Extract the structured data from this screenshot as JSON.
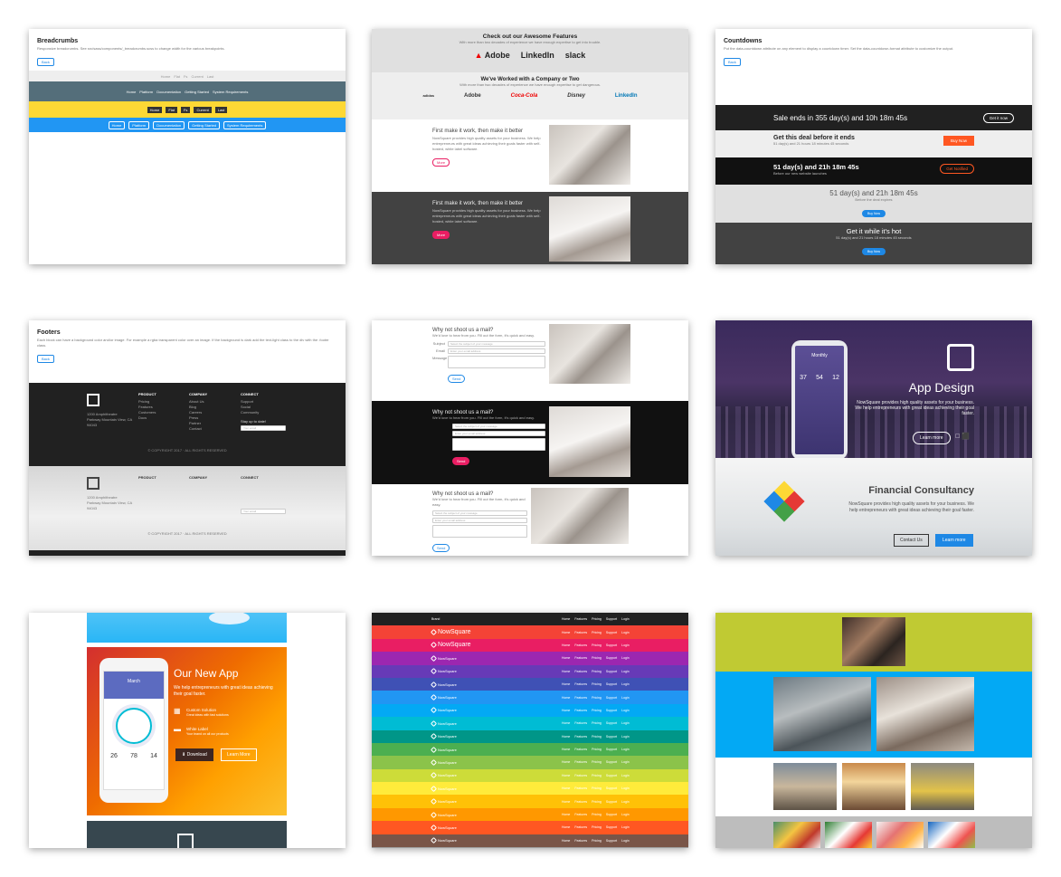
{
  "card1": {
    "title": "Breadcrumbs",
    "desc": "Responsive breadcrumbs. See src/sass/components/_breadcrumbs.scss to change width for the various breakpoints.",
    "button": "Back",
    "rows": [
      {
        "color": "#eeeeee",
        "items": [
          "Home",
          "Flat",
          "Fs",
          "Current",
          "Last"
        ]
      },
      {
        "color": "#546e7a",
        "items": [
          "Home",
          "Platform",
          "Documentation",
          "Getting Started",
          "System Requirements"
        ]
      },
      {
        "color": "#fdd835",
        "items": [
          "Home",
          "Flat",
          "Fs",
          "Current",
          "Last"
        ]
      },
      {
        "color": "#2196f3",
        "items": [
          "Home",
          "Platform",
          "Documentation",
          "Getting Started",
          "System Requirements"
        ]
      }
    ]
  },
  "card2": {
    "features_title": "Check out our Awesome Features",
    "features_sub": "With more than two decades of experience we have enough expertise to get into trouble.",
    "logos": [
      "Adobe",
      "LinkedIn",
      "slack"
    ],
    "worked_title": "We've Worked with a Company or Two",
    "worked_sub": "With more than two decades of experience we have enough expertise to get dangerous.",
    "logos2": [
      "adidas",
      "Adobe",
      "Coca-Cola",
      "Disney",
      "LinkedIn"
    ],
    "block_title": "First make it work, then make it better",
    "block_text": "NowSquare provides high quality assets for your business. We help entrepreneurs with great ideas achieving their goals faster with self-hosted, white label software.",
    "more": "More"
  },
  "card3": {
    "title": "Countdowns",
    "desc": "Put the data-countdown attribute on any element to display a countdown timer. Set the data-countdown-format attribute to customize the output.",
    "button": "Back",
    "rows": [
      {
        "text": "Sale ends in 355 day(s) and 10h 18m 45s",
        "button": "Get it now"
      },
      {
        "text": "Get this deal before it ends",
        "sub": "51 day(s) and 21 hours 18 minutes 45 seconds",
        "button": "Buy Now"
      },
      {
        "text": "51 day(s) and 21h 18m 45s",
        "sub": "Before our new website launches",
        "button": "Get Notified"
      },
      {
        "text": "51 day(s) and 21h 18m 45s",
        "sub": "Before the deal expires",
        "button": "Buy Now"
      },
      {
        "text": "Get it while it's hot",
        "sub": "51 day(s) and 21 hours 18 minutes 45 seconds",
        "button": "Buy Now"
      }
    ]
  },
  "card4": {
    "title": "Footers",
    "desc": "Each block can have a background color and/or image. For example a rgba transparent color over an image. If the background is dark add the text-light class to the div with the .footer class.",
    "columns": [
      "PRODUCT",
      "COMPANY",
      "CONNECT"
    ],
    "product_links": [
      "Pricing",
      "Features",
      "Customers",
      "Docs"
    ],
    "company_links": [
      "About Us",
      "Blog",
      "Careers",
      "Press",
      "Partner",
      "Contact"
    ],
    "connect_links": [
      "Support",
      "Social",
      "Community"
    ],
    "address": "1200 Amphitheatre Parkway Mountain View, CA 94043",
    "newsletter_label": "Stay up to date!",
    "newsletter_placeholder": "Your email",
    "copyright": "© COPYRIGHT 2017 · ALL RIGHTS RESERVED"
  },
  "card5": {
    "title": "Why not shoot us a mail?",
    "sub": "We'd love to hear from you. Fill out the form, it's quick and easy.",
    "subject_label": "Subject",
    "subject_placeholder": "Select the subject of your message",
    "email_label": "Email",
    "email_placeholder": "Enter your email address",
    "message_label": "Message",
    "send": "Send"
  },
  "card6": {
    "app_title": "App Design",
    "app_text": "NowSquare provides high quality assets for your business. We help entrepreneurs with great ideas achieving their goal faster.",
    "learn_more": "Learn more",
    "phone_month": "Monthly",
    "phone_stats": [
      "37",
      "54",
      "12"
    ],
    "fin_title": "Financial Consultancy",
    "fin_text": "NowSquare provides high quality assets for your business. We help entrepreneurs with great ideas achieving their goal faster.",
    "contact": "Contact Us",
    "learn_more2": "Learn more"
  },
  "card7": {
    "title": "Our New App",
    "text": "We help entrepreneurs with great ideas achieving their goal faster.",
    "feature1_title": "Custom Solution",
    "feature1_text": "Great ideas with fast solutions",
    "feature2_title": "White Label",
    "feature2_text": "Your brand on all our products",
    "download": "Download",
    "learn_more": "Learn More",
    "phone_month": "March",
    "phone_stats": [
      "26",
      "78",
      "14"
    ]
  },
  "card8": {
    "top_brand": "Brand",
    "brand": "NowSquare",
    "links": [
      "Home",
      "Features",
      "Pricing",
      "Support",
      "Login"
    ],
    "colors": [
      "#212121",
      "#f44336",
      "#e91e63",
      "#9c27b0",
      "#673ab7",
      "#3f51b5",
      "#2196f3",
      "#03a9f4",
      "#00bcd4",
      "#009688",
      "#4caf50",
      "#8bc34a",
      "#cddc39",
      "#ffeb3b",
      "#ffc107",
      "#ff9800",
      "#ff5722",
      "#795548",
      "#9e9e9e"
    ]
  },
  "card9": {
    "bands": [
      "#c0ca33",
      "#03a9f4",
      "#ffffff",
      "#bdbdbd"
    ]
  }
}
